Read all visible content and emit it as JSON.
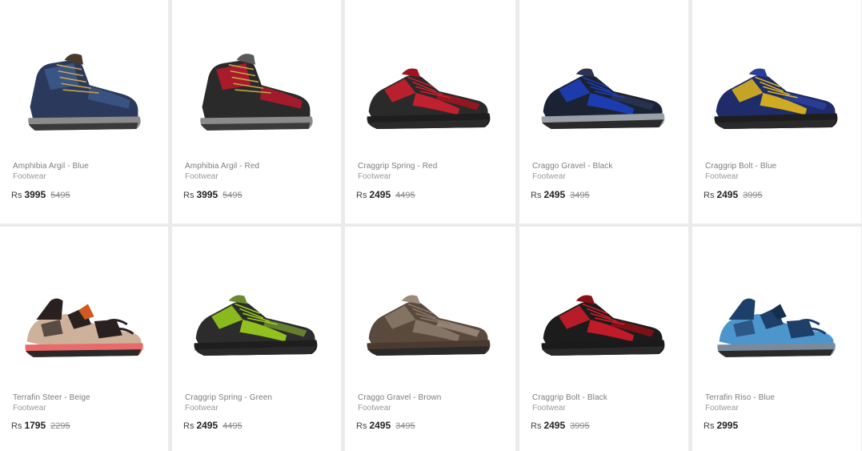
{
  "products": [
    {
      "name": "Amphibia Argil - Blue",
      "category": "Footwear",
      "currency": "Rs",
      "price": "3995",
      "old_price": "5495",
      "colors": {
        "upper": "#2b3a5c",
        "accent": "#3c5a8c",
        "sole": "#8b8b8b",
        "trim": "#4a3a2a"
      },
      "style": "boot"
    },
    {
      "name": "Amphibia Argil - Red",
      "category": "Footwear",
      "currency": "Rs",
      "price": "3995",
      "old_price": "5495",
      "colors": {
        "upper": "#2a2a2a",
        "accent": "#c0182a",
        "sole": "#8b8b8b",
        "trim": "#5a5a5a"
      },
      "style": "boot"
    },
    {
      "name": "Craggrip Spring - Red",
      "category": "Footwear",
      "currency": "Rs",
      "price": "2495",
      "old_price": "4495",
      "colors": {
        "upper": "#2a2a2a",
        "accent": "#d21f2f",
        "sole": "#1e1e1e",
        "trim": "#a01420"
      },
      "style": "low"
    },
    {
      "name": "Craggo Gravel - Black",
      "category": "Footwear",
      "currency": "Rs",
      "price": "2495",
      "old_price": "3495",
      "colors": {
        "upper": "#1b2233",
        "accent": "#1d3fbf",
        "sole": "#9aa0a8",
        "trim": "#2a3350"
      },
      "style": "low"
    },
    {
      "name": "Craggrip Bolt - Blue",
      "category": "Footwear",
      "currency": "Rs",
      "price": "2495",
      "old_price": "3995",
      "colors": {
        "upper": "#1f2c6a",
        "accent": "#e3b81a",
        "sole": "#1e1e1e",
        "trim": "#2b3f9a"
      },
      "style": "low"
    },
    {
      "name": "Terrafin Steer - Beige",
      "category": "Footwear",
      "currency": "Rs",
      "price": "1795",
      "old_price": "2295",
      "colors": {
        "upper": "#2a2020",
        "accent": "#c8a890",
        "sole": "#e86a6a",
        "trim": "#d05a20"
      },
      "style": "sandal"
    },
    {
      "name": "Craggrip Spring - Green",
      "category": "Footwear",
      "currency": "Rs",
      "price": "2495",
      "old_price": "4495",
      "colors": {
        "upper": "#2c2c2c",
        "accent": "#9bd21c",
        "sole": "#1e1e1e",
        "trim": "#6a8a30"
      },
      "style": "low"
    },
    {
      "name": "Craggo Gravel - Brown",
      "category": "Footwear",
      "currency": "Rs",
      "price": "2495",
      "old_price": "3495",
      "colors": {
        "upper": "#5a4a3e",
        "accent": "#8a7a6c",
        "sole": "#4a3a30",
        "trim": "#9a8a7a"
      },
      "style": "low"
    },
    {
      "name": "Craggrip Bolt - Black",
      "category": "Footwear",
      "currency": "Rs",
      "price": "2495",
      "old_price": "3995",
      "colors": {
        "upper": "#1c1c1c",
        "accent": "#d41c2c",
        "sole": "#1a1a1a",
        "trim": "#8a1018"
      },
      "style": "low"
    },
    {
      "name": "Terrafin Riso - Blue",
      "category": "Footwear",
      "currency": "Rs",
      "price": "2995",
      "old_price": "",
      "colors": {
        "upper": "#1e3f6a",
        "accent": "#3a8ac8",
        "sole": "#7a8a9a",
        "trim": "#14304e"
      },
      "style": "sandal"
    }
  ]
}
